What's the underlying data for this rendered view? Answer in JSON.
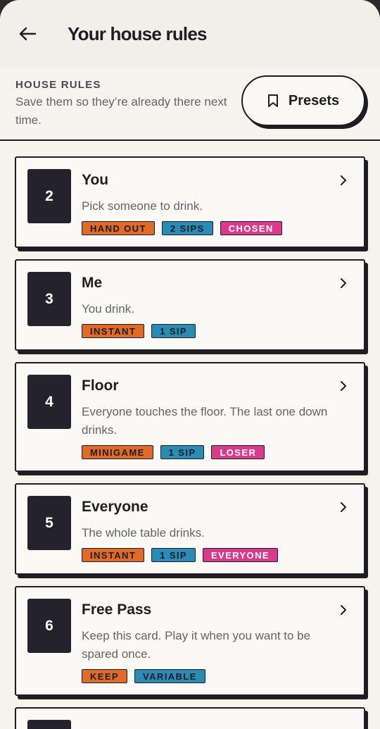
{
  "header": {
    "title": "Your house rules"
  },
  "section": {
    "label": "HOUSE RULES",
    "subtitle": "Save them so they’re already there next time.",
    "presets_label": "Presets"
  },
  "rules": [
    {
      "number": "2",
      "title": "You",
      "description": "Pick someone to drink.",
      "tags": [
        {
          "label": "HAND OUT",
          "color": "orange"
        },
        {
          "label": "2 SIPS",
          "color": "blue"
        },
        {
          "label": "CHOSEN",
          "color": "pink"
        }
      ]
    },
    {
      "number": "3",
      "title": "Me",
      "description": "You drink.",
      "tags": [
        {
          "label": "INSTANT",
          "color": "orange"
        },
        {
          "label": "1 SIP",
          "color": "blue"
        }
      ]
    },
    {
      "number": "4",
      "title": "Floor",
      "description": "Everyone touches the floor. The last one down drinks.",
      "tags": [
        {
          "label": "MINIGAME",
          "color": "orange"
        },
        {
          "label": "1 SIP",
          "color": "blue"
        },
        {
          "label": "LOSER",
          "color": "pink"
        }
      ]
    },
    {
      "number": "5",
      "title": "Everyone",
      "description": "The whole table drinks.",
      "tags": [
        {
          "label": "INSTANT",
          "color": "orange"
        },
        {
          "label": "1 SIP",
          "color": "blue"
        },
        {
          "label": "EVERYONE",
          "color": "pink"
        }
      ]
    },
    {
      "number": "6",
      "title": "Free Pass",
      "description": "Keep this card. Play it when you want to be spared once.",
      "tags": [
        {
          "label": "KEEP",
          "color": "orange"
        },
        {
          "label": "VARIABLE",
          "color": "blue"
        }
      ]
    }
  ]
}
